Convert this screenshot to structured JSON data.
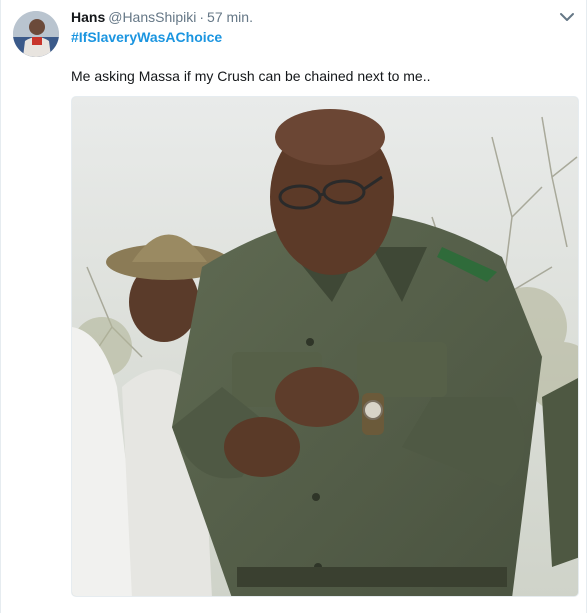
{
  "tweet": {
    "author_name": "Hans",
    "handle": "@HansShipiki",
    "separator": "·",
    "time": "57 min.",
    "hashtag": "#IfSlaveryWasAChoice",
    "text": "Me asking Massa if my Crush can be chained next to me.."
  },
  "colors": {
    "link": "#1b95e0",
    "secondary_text": "#657786",
    "primary_text": "#14171a",
    "border": "#e6ecf0"
  },
  "icons": {
    "caret": "chevron-down-icon"
  }
}
